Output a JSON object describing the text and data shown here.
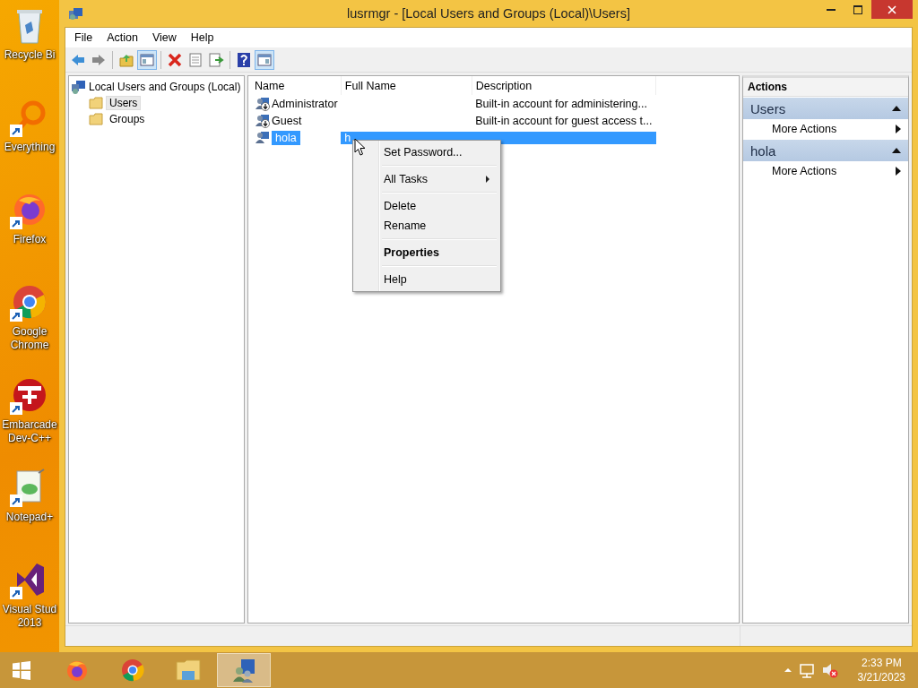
{
  "desktop_icons": [
    {
      "kind": "recycle",
      "label": "Recycle Bi"
    },
    {
      "kind": "everything",
      "label": "Everything"
    },
    {
      "kind": "firefox",
      "label": "Firefox"
    },
    {
      "kind": "chrome",
      "label": "Google Chrome"
    },
    {
      "kind": "devcpp",
      "label": "Embarcade Dev-C++"
    },
    {
      "kind": "notepad",
      "label": "Notepad+"
    },
    {
      "kind": "vs",
      "label": "Visual Stud 2013"
    }
  ],
  "window": {
    "title": "lusrmgr - [Local Users and Groups (Local)\\Users]"
  },
  "menu_bar": [
    "File",
    "Action",
    "View",
    "Help"
  ],
  "toolbar": [
    {
      "kind": "back",
      "pressed": false
    },
    {
      "kind": "forward",
      "pressed": false
    },
    {
      "kind": "separator"
    },
    {
      "kind": "up",
      "pressed": false
    },
    {
      "kind": "tree",
      "pressed": true
    },
    {
      "kind": "separator"
    },
    {
      "kind": "delete",
      "pressed": false
    },
    {
      "kind": "properties",
      "pressed": false
    },
    {
      "kind": "export",
      "pressed": false
    },
    {
      "kind": "separator"
    },
    {
      "kind": "help",
      "pressed": false
    },
    {
      "kind": "actionpane",
      "pressed": true
    }
  ],
  "tree": {
    "label": "Local Users and Groups (Local)",
    "children": [
      {
        "label": "Users",
        "selected": true
      },
      {
        "label": "Groups",
        "selected": false
      }
    ]
  },
  "table": {
    "columns": [
      "Name",
      "Full Name",
      "Description"
    ],
    "rows": [
      {
        "name": "Administrator",
        "description": "Built-in account for administering...",
        "disabled": true,
        "selected": false
      },
      {
        "name": "Guest",
        "description": "Built-in account for guest access t...",
        "disabled": true,
        "selected": false
      },
      {
        "name": "hola",
        "full_name": "h",
        "disabled": false,
        "selected": true
      }
    ]
  },
  "context_menu": {
    "items": [
      {
        "kind": "item",
        "label": "Set Password..."
      },
      {
        "kind": "separator"
      },
      {
        "kind": "submenu",
        "label": "All Tasks"
      },
      {
        "kind": "separator"
      },
      {
        "kind": "item",
        "label": "Delete"
      },
      {
        "kind": "item",
        "label": "Rename"
      },
      {
        "kind": "separator"
      },
      {
        "kind": "default",
        "label": "Properties"
      },
      {
        "kind": "separator"
      },
      {
        "kind": "item",
        "label": "Help"
      }
    ]
  },
  "actions_pane": {
    "title": "Actions",
    "sections": [
      {
        "title": "Users",
        "expanded": true,
        "items": [
          "More Actions"
        ]
      },
      {
        "title": "hola",
        "expanded": true,
        "items": [
          "More Actions"
        ]
      }
    ]
  },
  "taskbar": {
    "apps": [
      {
        "kind": "firefox",
        "active": false
      },
      {
        "kind": "chrome",
        "active": false
      },
      {
        "kind": "explorer",
        "active": false
      },
      {
        "kind": "users",
        "active": true
      }
    ],
    "time": "2:33 PM",
    "date": "3/21/2023"
  }
}
